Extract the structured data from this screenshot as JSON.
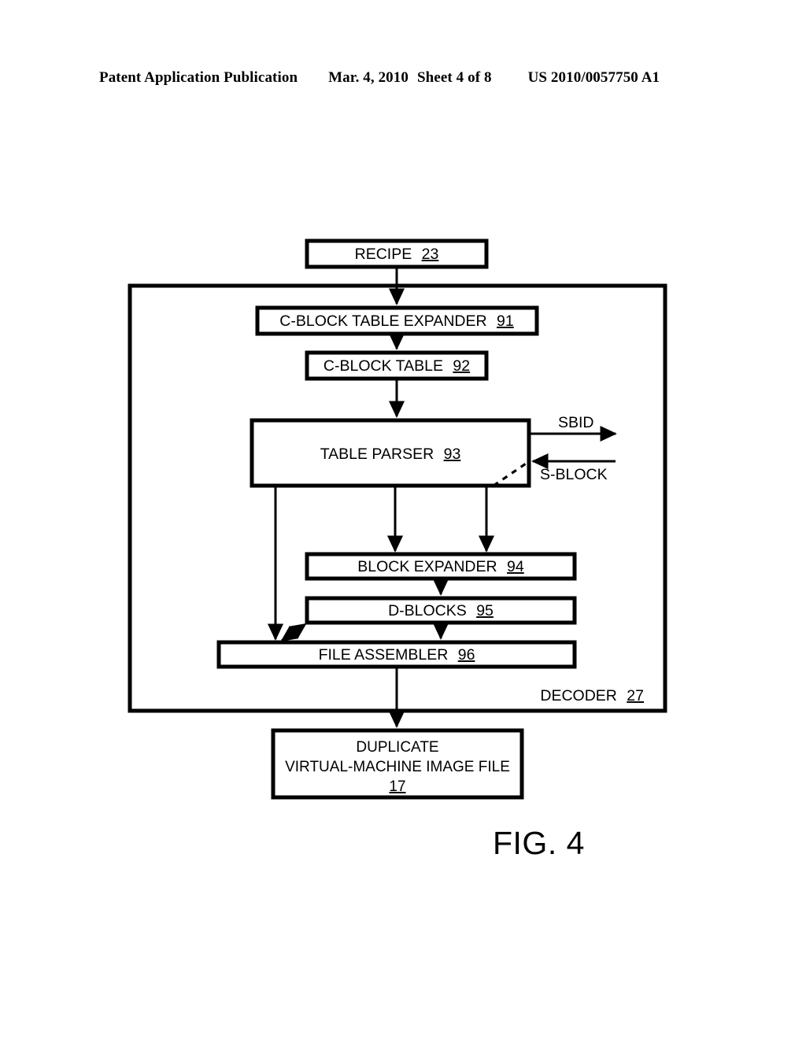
{
  "header": {
    "publication": "Patent Application Publication",
    "date": "Mar. 4, 2010",
    "sheet": "Sheet 4 of 8",
    "patent_number": "US 2010/0057750 A1"
  },
  "figure": {
    "caption": "FIG. 4",
    "container": {
      "label": "DECODER",
      "ref": "27"
    },
    "blocks": [
      {
        "id": "recipe",
        "label": "RECIPE",
        "ref": "23"
      },
      {
        "id": "cblock_expander",
        "label": "C-BLOCK TABLE EXPANDER",
        "ref": "91"
      },
      {
        "id": "cblock_table",
        "label": "C-BLOCK TABLE",
        "ref": "92"
      },
      {
        "id": "table_parser",
        "label": "TABLE PARSER",
        "ref": "93"
      },
      {
        "id": "block_expander",
        "label": "BLOCK EXPANDER",
        "ref": "94"
      },
      {
        "id": "d_blocks",
        "label": "D-BLOCKS",
        "ref": "95"
      },
      {
        "id": "file_assembler",
        "label": "FILE ASSEMBLER",
        "ref": "96"
      }
    ],
    "output_block": {
      "id": "duplicate_vm_image_file",
      "line1": "DUPLICATE",
      "line2": "VIRTUAL-MACHINE IMAGE FILE",
      "ref": "17"
    },
    "signals": [
      {
        "id": "sbid",
        "label": "SBID",
        "direction": "out"
      },
      {
        "id": "s_block",
        "label": "S-BLOCK",
        "direction": "in"
      }
    ],
    "colors": {
      "ink": "#000000",
      "paper": "#ffffff"
    }
  }
}
